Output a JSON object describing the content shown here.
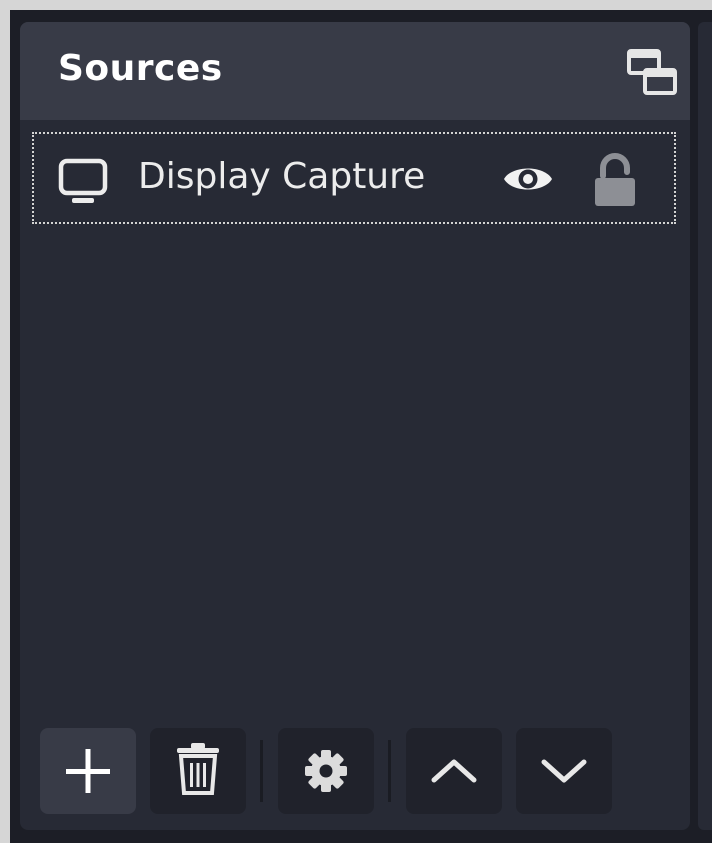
{
  "dock": {
    "title": "Sources",
    "float_icon": "undock-icon"
  },
  "sources": [
    {
      "name": "Display Capture",
      "type_icon": "monitor-icon",
      "visible": true,
      "locked": false,
      "selected": true
    }
  ],
  "toolbar": {
    "buttons": [
      {
        "icon": "plus-icon",
        "action": "add-source"
      },
      {
        "icon": "trash-icon",
        "action": "remove-source"
      },
      {
        "icon": "gear-icon",
        "action": "source-properties"
      },
      {
        "icon": "chevron-up-icon",
        "action": "move-up"
      },
      {
        "icon": "chevron-down-icon",
        "action": "move-down"
      }
    ]
  },
  "colors": {
    "dock_bg": "#272a35",
    "header_bg": "#383b47",
    "button_bg": "#20222b",
    "text": "#ffffff"
  }
}
